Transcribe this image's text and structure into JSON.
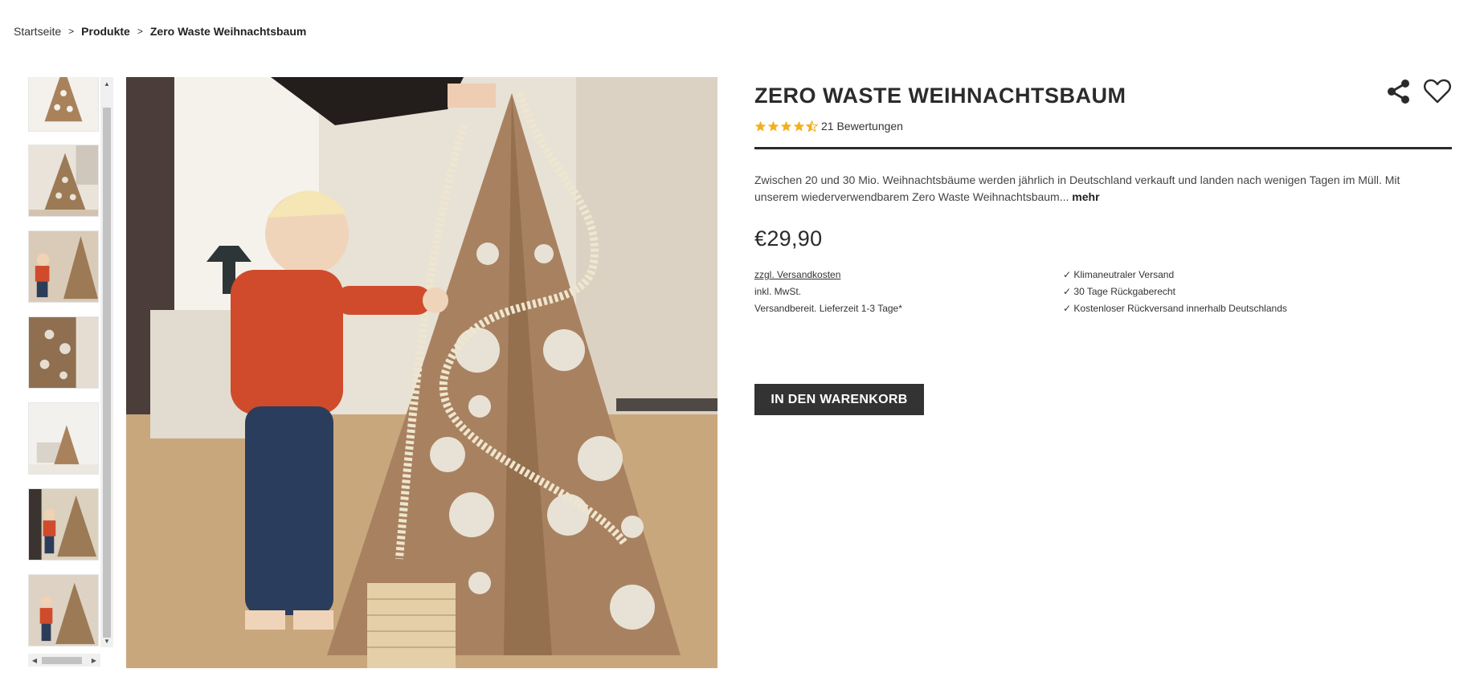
{
  "breadcrumb": {
    "home": "Startseite",
    "separator": ">",
    "category": "Produkte",
    "current": "Zero Waste Weihnachtsbaum"
  },
  "thumbnails": {
    "count": 7
  },
  "scrollbars": {
    "up_arrow": "▲",
    "down_arrow": "▼",
    "left_arrow": "◀",
    "right_arrow": "▶"
  },
  "product": {
    "title": "ZERO WASTE WEIHNACHTSBAUM",
    "rating_value": 4.5,
    "rating_max": 5,
    "rating_text": "21 Bewertungen",
    "description": "Zwischen 20 und 30 Mio. Weihnachtsbäume werden jährlich in Deutschland verkauft und landen nach wenigen Tagen im Müll. Mit unserem wiederverwendbarem Zero Waste Weihnachtsbaum...",
    "more_label": "mehr",
    "price": "€29,90",
    "shipping_link": "zzgl. Versandkosten",
    "vat_text": "inkl. MwSt.",
    "delivery_text": "Versandbereit. Lieferzeit 1-3 Tage*",
    "benefits": [
      "✓ Klimaneutraler Versand",
      "✓ 30 Tage Rückgaberecht",
      "✓ Kostenloser Rückversand innerhalb Deutschlands"
    ],
    "cart_button": "IN DEN WARENKORB"
  },
  "icons": {
    "share": "share-icon",
    "wishlist": "heart-icon",
    "star": "star-icon"
  },
  "colors": {
    "text": "#2b2b2b",
    "star": "#f2b01e",
    "button_bg": "#333333",
    "cardboard": "#9a7a58"
  }
}
